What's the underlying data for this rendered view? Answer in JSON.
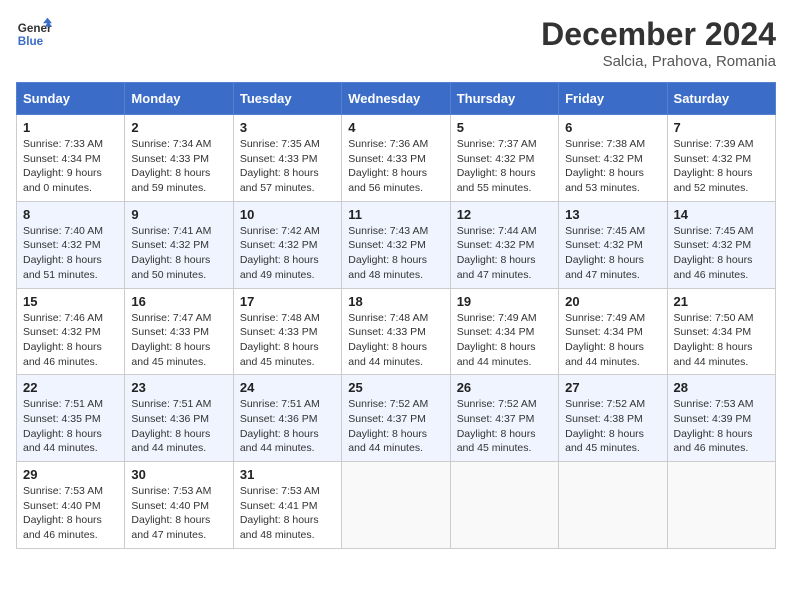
{
  "header": {
    "logo_line1": "General",
    "logo_line2": "Blue",
    "month_year": "December 2024",
    "location": "Salcia, Prahova, Romania"
  },
  "days_of_week": [
    "Sunday",
    "Monday",
    "Tuesday",
    "Wednesday",
    "Thursday",
    "Friday",
    "Saturday"
  ],
  "weeks": [
    [
      {
        "day": "1",
        "sunrise": "7:33 AM",
        "sunset": "4:34 PM",
        "daylight": "9 hours and 0 minutes."
      },
      {
        "day": "2",
        "sunrise": "7:34 AM",
        "sunset": "4:33 PM",
        "daylight": "8 hours and 59 minutes."
      },
      {
        "day": "3",
        "sunrise": "7:35 AM",
        "sunset": "4:33 PM",
        "daylight": "8 hours and 57 minutes."
      },
      {
        "day": "4",
        "sunrise": "7:36 AM",
        "sunset": "4:33 PM",
        "daylight": "8 hours and 56 minutes."
      },
      {
        "day": "5",
        "sunrise": "7:37 AM",
        "sunset": "4:32 PM",
        "daylight": "8 hours and 55 minutes."
      },
      {
        "day": "6",
        "sunrise": "7:38 AM",
        "sunset": "4:32 PM",
        "daylight": "8 hours and 53 minutes."
      },
      {
        "day": "7",
        "sunrise": "7:39 AM",
        "sunset": "4:32 PM",
        "daylight": "8 hours and 52 minutes."
      }
    ],
    [
      {
        "day": "8",
        "sunrise": "7:40 AM",
        "sunset": "4:32 PM",
        "daylight": "8 hours and 51 minutes."
      },
      {
        "day": "9",
        "sunrise": "7:41 AM",
        "sunset": "4:32 PM",
        "daylight": "8 hours and 50 minutes."
      },
      {
        "day": "10",
        "sunrise": "7:42 AM",
        "sunset": "4:32 PM",
        "daylight": "8 hours and 49 minutes."
      },
      {
        "day": "11",
        "sunrise": "7:43 AM",
        "sunset": "4:32 PM",
        "daylight": "8 hours and 48 minutes."
      },
      {
        "day": "12",
        "sunrise": "7:44 AM",
        "sunset": "4:32 PM",
        "daylight": "8 hours and 47 minutes."
      },
      {
        "day": "13",
        "sunrise": "7:45 AM",
        "sunset": "4:32 PM",
        "daylight": "8 hours and 47 minutes."
      },
      {
        "day": "14",
        "sunrise": "7:45 AM",
        "sunset": "4:32 PM",
        "daylight": "8 hours and 46 minutes."
      }
    ],
    [
      {
        "day": "15",
        "sunrise": "7:46 AM",
        "sunset": "4:32 PM",
        "daylight": "8 hours and 46 minutes."
      },
      {
        "day": "16",
        "sunrise": "7:47 AM",
        "sunset": "4:33 PM",
        "daylight": "8 hours and 45 minutes."
      },
      {
        "day": "17",
        "sunrise": "7:48 AM",
        "sunset": "4:33 PM",
        "daylight": "8 hours and 45 minutes."
      },
      {
        "day": "18",
        "sunrise": "7:48 AM",
        "sunset": "4:33 PM",
        "daylight": "8 hours and 44 minutes."
      },
      {
        "day": "19",
        "sunrise": "7:49 AM",
        "sunset": "4:34 PM",
        "daylight": "8 hours and 44 minutes."
      },
      {
        "day": "20",
        "sunrise": "7:49 AM",
        "sunset": "4:34 PM",
        "daylight": "8 hours and 44 minutes."
      },
      {
        "day": "21",
        "sunrise": "7:50 AM",
        "sunset": "4:34 PM",
        "daylight": "8 hours and 44 minutes."
      }
    ],
    [
      {
        "day": "22",
        "sunrise": "7:51 AM",
        "sunset": "4:35 PM",
        "daylight": "8 hours and 44 minutes."
      },
      {
        "day": "23",
        "sunrise": "7:51 AM",
        "sunset": "4:36 PM",
        "daylight": "8 hours and 44 minutes."
      },
      {
        "day": "24",
        "sunrise": "7:51 AM",
        "sunset": "4:36 PM",
        "daylight": "8 hours and 44 minutes."
      },
      {
        "day": "25",
        "sunrise": "7:52 AM",
        "sunset": "4:37 PM",
        "daylight": "8 hours and 44 minutes."
      },
      {
        "day": "26",
        "sunrise": "7:52 AM",
        "sunset": "4:37 PM",
        "daylight": "8 hours and 45 minutes."
      },
      {
        "day": "27",
        "sunrise": "7:52 AM",
        "sunset": "4:38 PM",
        "daylight": "8 hours and 45 minutes."
      },
      {
        "day": "28",
        "sunrise": "7:53 AM",
        "sunset": "4:39 PM",
        "daylight": "8 hours and 46 minutes."
      }
    ],
    [
      {
        "day": "29",
        "sunrise": "7:53 AM",
        "sunset": "4:40 PM",
        "daylight": "8 hours and 46 minutes."
      },
      {
        "day": "30",
        "sunrise": "7:53 AM",
        "sunset": "4:40 PM",
        "daylight": "8 hours and 47 minutes."
      },
      {
        "day": "31",
        "sunrise": "7:53 AM",
        "sunset": "4:41 PM",
        "daylight": "8 hours and 48 minutes."
      },
      null,
      null,
      null,
      null
    ]
  ],
  "labels": {
    "sunrise": "Sunrise:",
    "sunset": "Sunset:",
    "daylight": "Daylight:"
  }
}
